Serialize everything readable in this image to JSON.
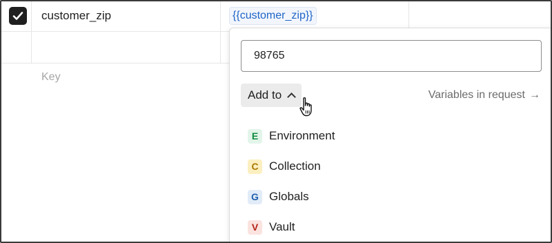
{
  "table": {
    "row1": {
      "checked": true,
      "key": "customer_zip",
      "value": "{{customer_zip}}"
    },
    "row2": {
      "key_placeholder": "Key"
    }
  },
  "popover": {
    "input_value": "98765",
    "add_to_label": "Add to",
    "variables_link": "Variables in request",
    "variables_link_arrow": "→",
    "menu": [
      {
        "badge": "E",
        "label": "Environment",
        "color": "#0f8a3f"
      },
      {
        "badge": "C",
        "label": "Collection",
        "color": "#a87b00"
      },
      {
        "badge": "G",
        "label": "Globals",
        "color": "#1f5fae"
      },
      {
        "badge": "V",
        "label": "Vault",
        "color": "#b5231a"
      }
    ]
  },
  "icons": {
    "checkbox": "check-icon",
    "add_to": "chevron-up-icon",
    "pointer": "hand-pointer-icon"
  },
  "colors": {
    "variable_tag_text": "#1f64c7",
    "checkbox_fill": "#1f1f1f"
  }
}
